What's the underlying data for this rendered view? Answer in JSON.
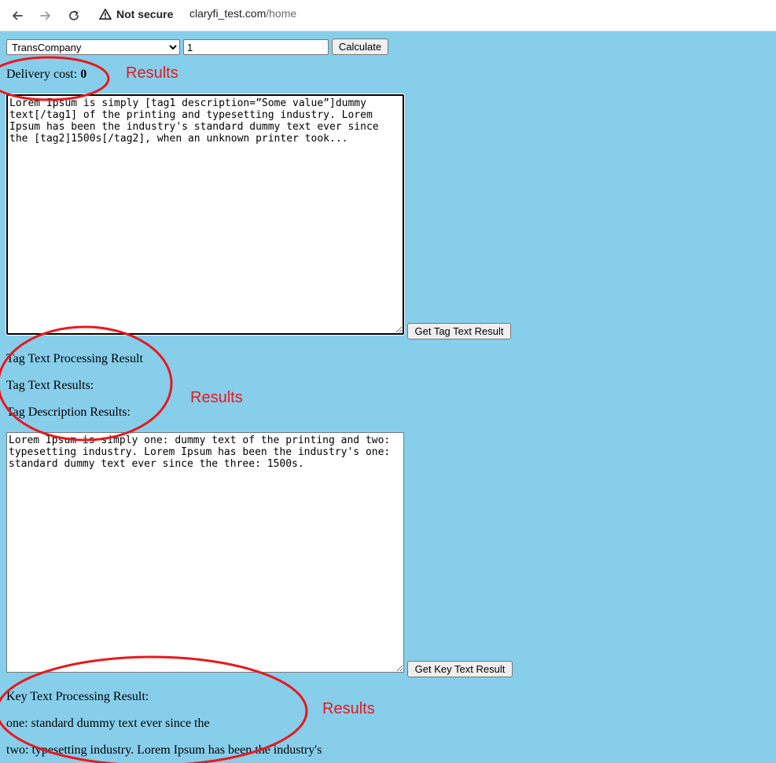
{
  "browser": {
    "security_label": "Not secure",
    "url_host": "claryfi_test.com",
    "url_path": "/home"
  },
  "form": {
    "company_selected": "TransCompany",
    "company_options": [
      "TransCompany"
    ],
    "quantity_value": "1",
    "calculate_label": "Calculate"
  },
  "delivery": {
    "label": "Delivery cost: ",
    "value": "0"
  },
  "tag_input": {
    "text": "Lorem Ipsum is simply [tag1 description=”Some value”]dummy text[/tag1] of the printing and typesetting industry. Lorem Ipsum has been the industry's standard dummy text ever since the [tag2]1500s[/tag2], when an unknown printer took...",
    "button_label": "Get Tag Text Result"
  },
  "tag_results": {
    "processing_label": "Tag Text Processing Result",
    "text_results_label": "Tag Text Results:",
    "description_results_label": "Tag Description Results:"
  },
  "key_input": {
    "text": "Lorem Ipsum is simply one: dummy text of the printing and two: typesetting industry. Lorem Ipsum has been the industry's one: standard dummy text ever since the three: 1500s.",
    "button_label": "Get Key Text Result"
  },
  "key_results": {
    "processing_label": "Key Text Processing Result:",
    "lines": [
      "one: standard dummy text ever since the",
      "two: typesetting industry. Lorem Ipsum has been the industry's"
    ]
  },
  "annotations": {
    "label": "Results",
    "color": "#e8191b"
  },
  "colors": {
    "page_background": "#87ceeb"
  },
  "icons": {
    "back": "back-arrow-icon",
    "forward": "forward-arrow-icon",
    "reload": "reload-icon",
    "warning": "warning-icon"
  }
}
